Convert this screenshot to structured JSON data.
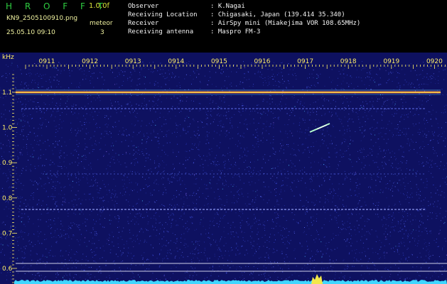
{
  "header": {
    "brand": "H R O F F T",
    "version": "1.0.0f",
    "filename": "KN9_2505100910.png",
    "timestamp": "25.05.10 09:10",
    "meteor_label": "meteor",
    "meteor_count": "3"
  },
  "metadata": [
    {
      "label": "Observer",
      "value": ": K.Nagai"
    },
    {
      "label": "Receiving Location",
      "value": ": Chigasaki, Japan (139.414 35.340)"
    },
    {
      "label": "Receiver",
      "value": ": AirSpy mini (Miakejima VOR 108.65MHz)"
    },
    {
      "label": "Receiving antenna",
      "value": ": Maspro FM-3"
    }
  ],
  "spectrogram": {
    "unit_label": "kHz",
    "time_ticks": [
      "0911",
      "0912",
      "0913",
      "0914",
      "0915",
      "0916",
      "0917",
      "0918",
      "0919",
      "0920"
    ],
    "freq_ticks": [
      "1.1",
      "1.0",
      "0.9",
      "0.8",
      "0.7",
      "0.6"
    ],
    "colors": {
      "background": "#101468",
      "noise": "#3a4cd8",
      "carrier": "#ffd24a",
      "axis_text": "#ffee66"
    }
  }
}
